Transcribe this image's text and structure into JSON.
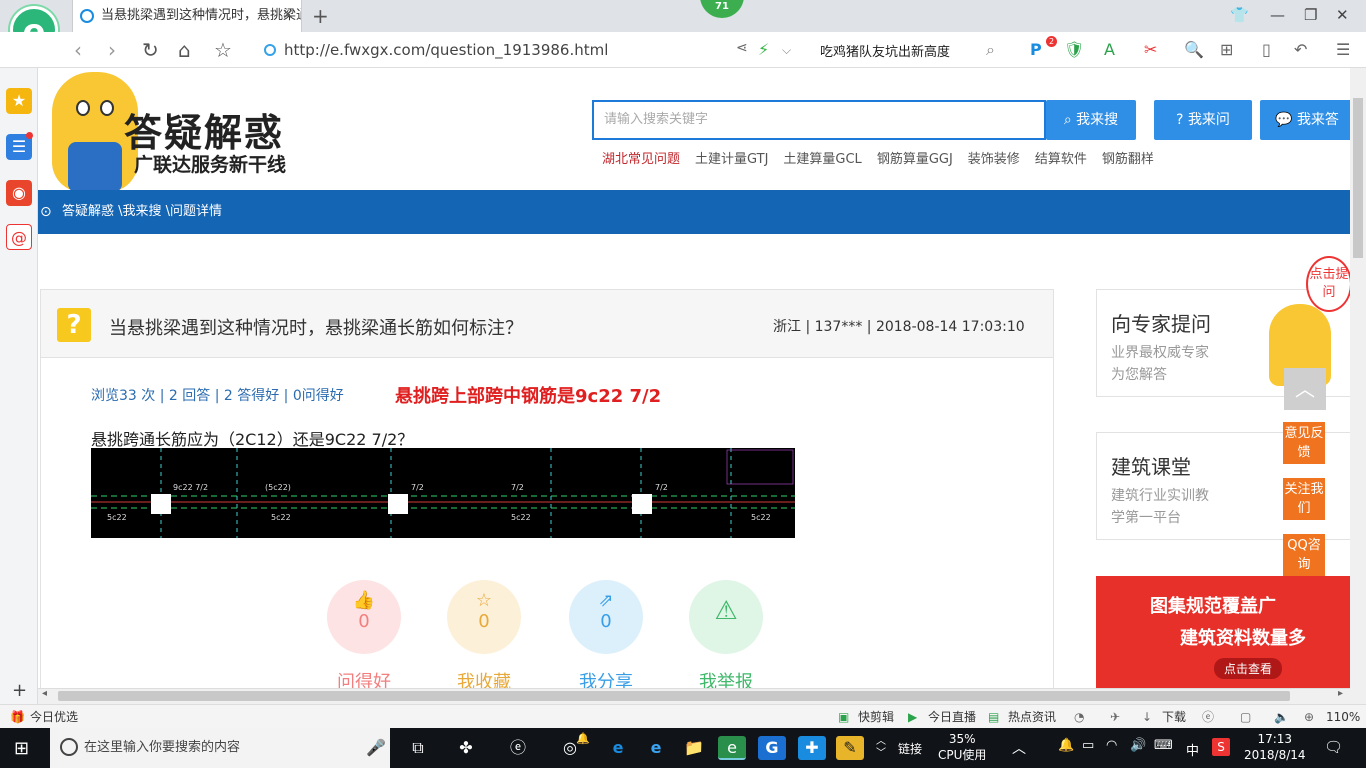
{
  "browser": {
    "tab_title": "当悬挑梁遇到这种情况时，悬挑梁通长筋如何标注？",
    "badge": "71",
    "url": "http://e.fwxgx.com/question_1913986.html",
    "news": "吃鸡猪队友坑出新高度",
    "extension_badge": "2"
  },
  "site": {
    "brand": "答疑解惑",
    "brand_sub": "广联达服务新干线",
    "search_placeholder": "请输入搜索关键字",
    "buttons": [
      "我来搜",
      "我来问",
      "我来答"
    ],
    "hotlinks": [
      "湖北常见问题",
      "土建计量GTJ",
      "土建算量GCL",
      "钢筋算量GGJ",
      "装饰装修",
      "结算软件",
      "钢筋翻样"
    ],
    "breadcrumb": "答疑解惑 \\我来搜 \\问题详情"
  },
  "question": {
    "title": "当悬挑梁遇到这种情况时，悬挑梁通长筋如何标注？",
    "meta": "浙江 | 137*** | 2018-08-14 17:03:10",
    "stats": "浏览33 次 | 2 回答 | 2 答得好 | 0问得好",
    "annotation": "悬挑跨上部跨中钢筋是9c22  7/2",
    "body": "悬挑跨通长筋应为（2C12）还是9C22 7/2？",
    "cad_labels": [
      "9c22 7/2",
      "(5c22)",
      "7/2",
      "7/2",
      "7/2",
      "5c22",
      "5c22",
      "5c22",
      "5c22"
    ],
    "actions": [
      {
        "count": "0",
        "label": "问得好",
        "color": "#f27f7f",
        "bg": "#fde3e3"
      },
      {
        "count": "0",
        "label": "我收藏",
        "color": "#e8a93a",
        "bg": "#fdf0d8"
      },
      {
        "count": "0",
        "label": "我分享",
        "color": "#3a9ee6",
        "bg": "#dcf0fb"
      },
      {
        "count": "",
        "label": "我举报",
        "color": "#3fb86a",
        "bg": "#dff5e6"
      }
    ]
  },
  "right": {
    "expert_title": "向专家提问",
    "expert_desc1": "业界最权威专家",
    "expert_desc2": "为您解答",
    "class_title": "建筑课堂",
    "class_desc1": "建筑行业实训教",
    "class_desc2": "学第一平台",
    "banner_line1": "图集规范覆盖广",
    "banner_line2": "建筑资料数量多",
    "banner_cta": "点击查看",
    "float_feedback": "意见反馈",
    "float_follow": "关注我们",
    "float_qq": "QQ咨询",
    "bubble": "点击提问"
  },
  "statusbar": {
    "left": "今日优选",
    "items": [
      "快剪辑",
      "今日直播",
      "热点资讯",
      "下载"
    ],
    "zoom": "110%"
  },
  "taskbar": {
    "search_placeholder": "在这里输入你要搜索的内容",
    "link": "链接",
    "cpu_value": "35%",
    "cpu_label": "CPU使用",
    "ime": "中",
    "time": "17:13",
    "date": "2018/8/14"
  }
}
